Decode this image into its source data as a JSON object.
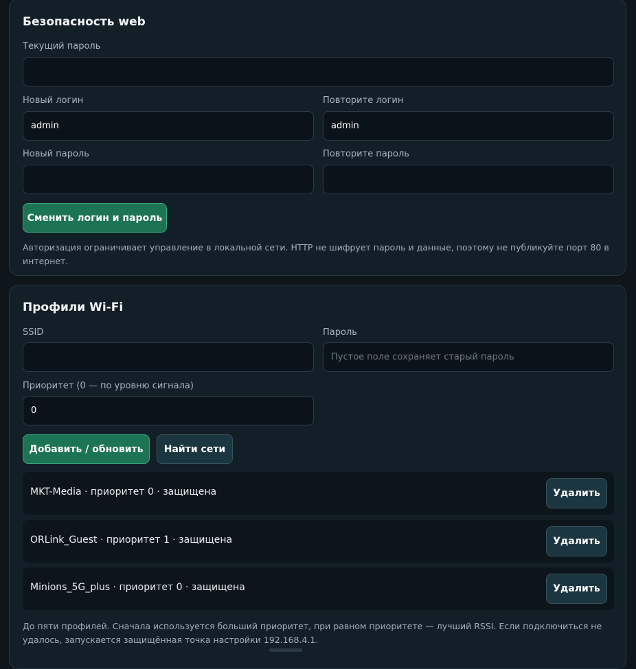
{
  "security": {
    "title": "Безопасность web",
    "current_password_label": "Текущий пароль",
    "current_password_value": "",
    "new_login_label": "Новый логин",
    "new_login_value": "admin",
    "repeat_login_label": "Повторите логин",
    "repeat_login_value": "admin",
    "new_password_label": "Новый пароль",
    "new_password_value": "",
    "repeat_password_label": "Повторите пароль",
    "repeat_password_value": "",
    "submit_label": "Сменить логин и пароль",
    "hint": "Авторизация ограничивает управление в локальной сети. HTTP не шифрует пароль и данные, поэтому не публикуйте порт 80 в интернет."
  },
  "wifi": {
    "title": "Профили Wi-Fi",
    "ssid_label": "SSID",
    "ssid_value": "",
    "password_label": "Пароль",
    "password_placeholder": "Пустое поле сохраняет старый пароль",
    "priority_label": "Приоритет (0 — по уровню сигнала)",
    "priority_value": "0",
    "add_label": "Добавить / обновить",
    "scan_label": "Найти сети",
    "profiles": [
      {
        "text": "MKT-Media · приоритет 0 · защищена",
        "delete_label": "Удалить"
      },
      {
        "text": "ORLink_Guest · приоритет 1 · защищена",
        "delete_label": "Удалить"
      },
      {
        "text": "Minions_5G_plus · приоритет 0 · защищена",
        "delete_label": "Удалить"
      }
    ],
    "hint": "До пяти профилей. Сначала используется больший приоритет, при равном приоритете — лучший RSSI. Если подключиться не удалось, запускается защищённая точка настройки 192.168.4.1."
  },
  "colors": {
    "background": "#0e161c",
    "card": "#131f27",
    "primary_button": "#1d7455",
    "secondary_button": "#1b3641"
  }
}
